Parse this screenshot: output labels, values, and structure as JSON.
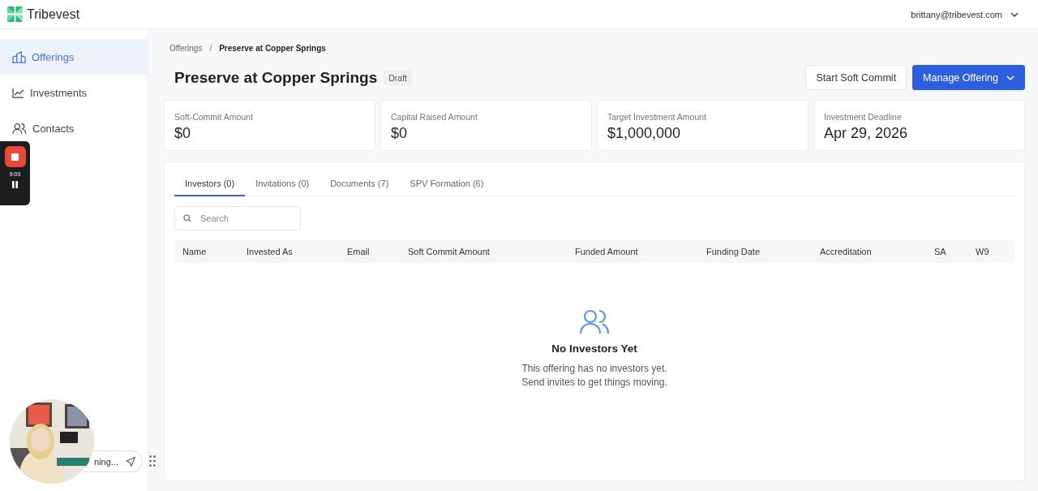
{
  "header": {
    "brand": "Tribevest",
    "user_email": "brittany@tribevest.com"
  },
  "sidebar": {
    "items": [
      {
        "label": "Offerings",
        "kind": "building",
        "selected": true
      },
      {
        "label": "Investments",
        "kind": "chart",
        "selected": false
      },
      {
        "label": "Contacts",
        "kind": "people",
        "selected": false
      }
    ]
  },
  "recorder": {
    "time": "9:00"
  },
  "webcam": {
    "kind": "picture",
    "caption": "ning..."
  },
  "breadcrumb": {
    "items": [
      "Offerings",
      "Preserve at Copper Springs"
    ],
    "separator": "/"
  },
  "title": "Preserve at Copper Springs",
  "status": "Draft",
  "buttons": [
    {
      "label": "Start Soft Commit",
      "kind": "secondary"
    },
    {
      "label": "Manage Offering",
      "kind": "primary"
    }
  ],
  "stats": [
    {
      "label": "Soft-Commit Amount",
      "value": "$0"
    },
    {
      "label": "Capital Raised Amount",
      "value": "$0"
    },
    {
      "label": "Target Investment Amount",
      "value": "$1,000,000"
    },
    {
      "label": "Investment Deadline",
      "value": "Apr 29, 2026"
    }
  ],
  "tabs": [
    {
      "label": "Investors (0)",
      "selected": true
    },
    {
      "label": "Invitations (0)",
      "selected": false
    },
    {
      "label": "Documents (7)",
      "selected": false
    },
    {
      "label": "SPV Formation (6)",
      "selected": false
    }
  ],
  "search": {
    "placeholder": "Search"
  },
  "table": {
    "columns": [
      "Name",
      "Invested As",
      "Email",
      "Soft Commit Amount",
      "Funded Amount",
      "Funding Date",
      "Accreditation",
      "SA",
      "W9"
    ]
  },
  "empty_state": {
    "title": "No Investors Yet",
    "lines": [
      "This offering has no investors yet.",
      "Send invites to get things moving."
    ]
  }
}
